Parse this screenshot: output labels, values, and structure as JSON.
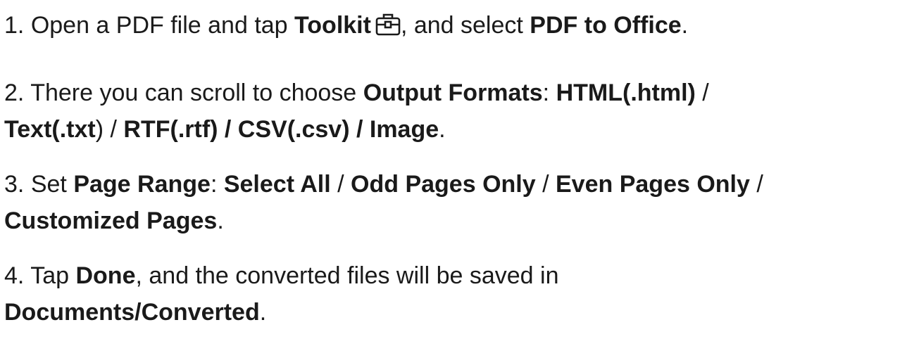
{
  "steps": [
    {
      "number": "1.",
      "text_a": "Open a PDF file and tap",
      "bold_toolkit": "Toolkit",
      "icon": "toolkit-briefcase-icon",
      "text_b": ", and select",
      "bold_pdf_to_office": "PDF to Office",
      "end": "."
    },
    {
      "number": "2.",
      "text_a": "There you can scroll to choose",
      "bold_output_formats": "Output Formats",
      "colon": ":",
      "bold_html": "HTML(.html)",
      "sep1": " /",
      "bold_text": "Text(.txt",
      "paren": ")",
      "sep2": " /",
      "bold_rest": "RTF(.rtf) / CSV(.csv) / Image",
      "end": "."
    },
    {
      "number": "3.",
      "text_a": "Set",
      "bold_page_range": "Page Range",
      "colon": ":",
      "bold_select_all": "Select All",
      "sep": "/",
      "bold_odd": "Odd Pages Only",
      "bold_even": "Even Pages Only",
      "sep_end": " /",
      "bold_customized": "Customized Pages",
      "end": "."
    },
    {
      "number": "4.",
      "text_a": "Tap",
      "bold_done": "Done",
      "text_b": ", and the converted files will be saved in",
      "bold_path": "Documents/Converted",
      "end": "."
    }
  ],
  "colors": {
    "text": "#1a1a1a",
    "background": "#ffffff"
  }
}
